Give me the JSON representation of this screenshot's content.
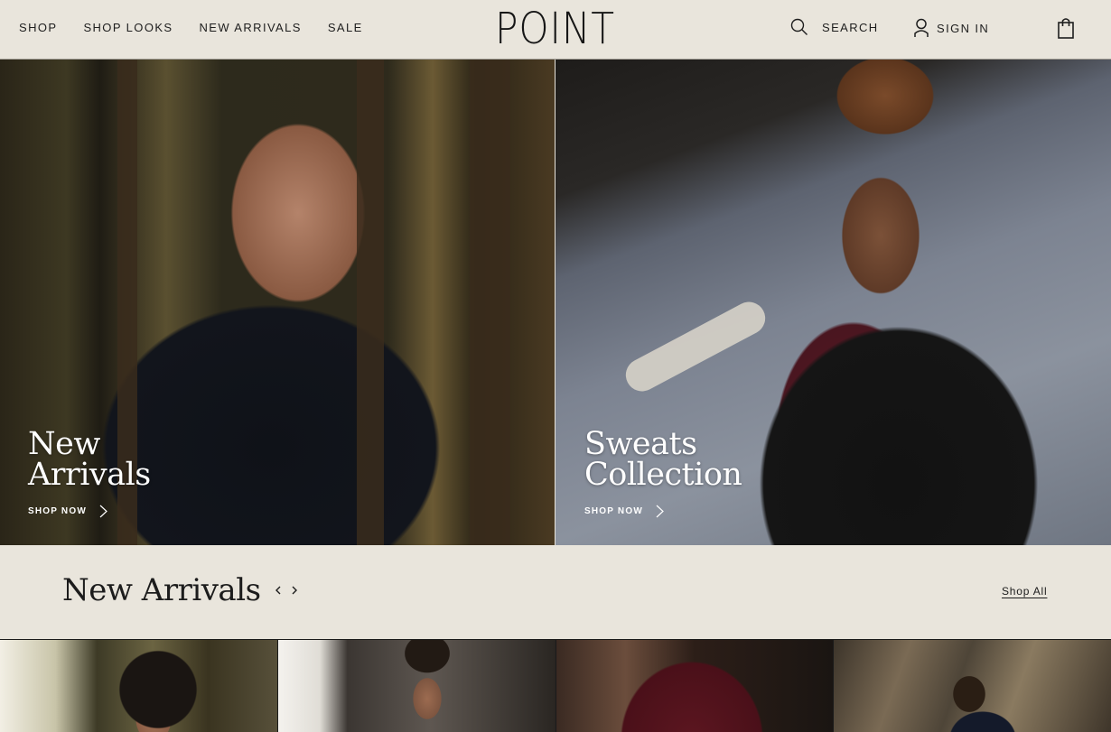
{
  "header": {
    "nav": [
      "SHOP",
      "SHOP LOOKS",
      "NEW ARRIVALS",
      "SALE"
    ],
    "logo": "POINT",
    "search_label": "SEARCH",
    "signin_label": "SIGN IN",
    "icons": {
      "search": "search-icon",
      "user": "user-icon",
      "cart": "shopping-bag-icon"
    }
  },
  "hero": {
    "left": {
      "title_line1": "New",
      "title_line2": "Arrivals",
      "cta": "SHOP NOW"
    },
    "right": {
      "title_line1": "Sweats",
      "title_line2": "Collection",
      "cta": "SHOP NOW"
    }
  },
  "section": {
    "title": "New Arrivals",
    "shop_all": "Shop All"
  },
  "colors": {
    "background": "#e9e5dc",
    "text": "#1b1b1b",
    "hero_text": "#ffffff"
  }
}
